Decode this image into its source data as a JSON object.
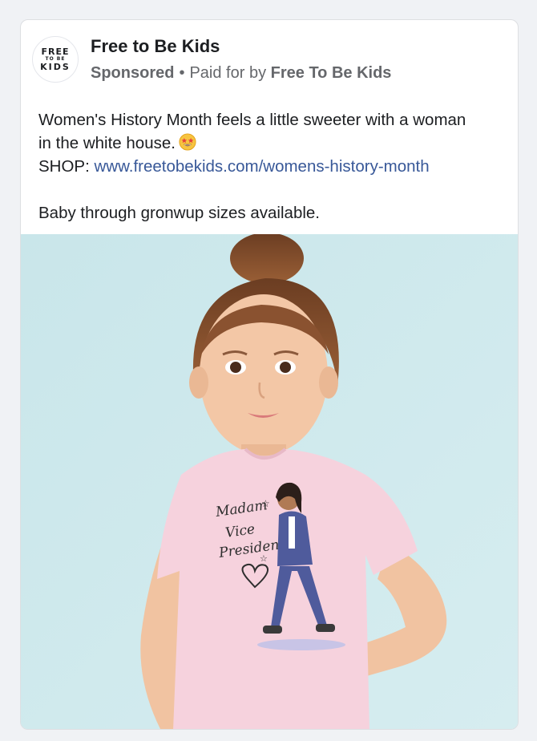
{
  "post": {
    "page_name": "Free to Be Kids",
    "avatar": {
      "line1": "FREE",
      "line2": "TO BE",
      "line3": "KIDS"
    },
    "sponsored_label": "Sponsored",
    "separator": "•",
    "paid_for_prefix": "Paid for by",
    "advertiser": "Free To Be Kids",
    "text_line1": "Women's History Month feels a little sweeter with a woman",
    "text_line2": "in the white house.",
    "emoji_icon": "star-struck-emoji-icon",
    "shop_prefix": "SHOP:",
    "shop_link": "www.freetobekids.com/womens-history-month",
    "text_line3": "Baby through gronwup sizes available."
  },
  "image": {
    "shirt_text": [
      "Madam",
      "Vice",
      "President"
    ]
  },
  "colors": {
    "background": "#f0f2f5",
    "link": "#385898",
    "secondary_text": "#65676b",
    "photo_background": "#cfe8ec",
    "shirt": "#f6d2dd",
    "jacket": "#4f5b9c"
  }
}
